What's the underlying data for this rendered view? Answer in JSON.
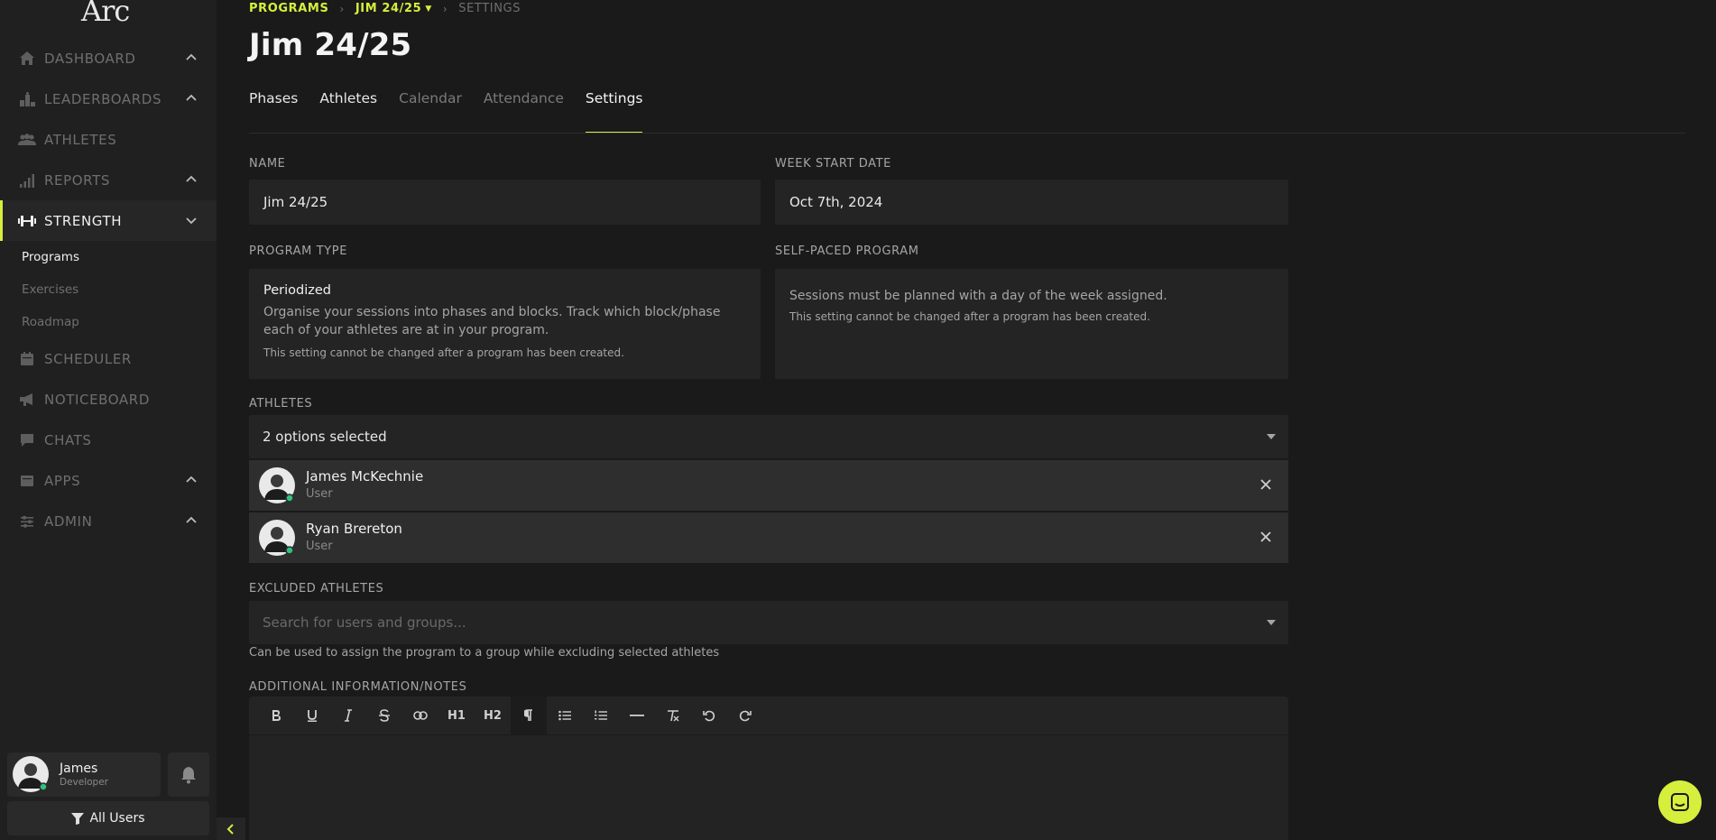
{
  "app": {
    "logo_text": "Arc",
    "brand_color": "#d6ef3c"
  },
  "sidebar": {
    "items": [
      {
        "label": "Dashboard",
        "icon": "home-icon",
        "expandable": true
      },
      {
        "label": "Leaderboards",
        "icon": "leaderboard-icon",
        "expandable": true
      },
      {
        "label": "Athletes",
        "icon": "users-icon",
        "expandable": false
      },
      {
        "label": "Reports",
        "icon": "bar-chart-icon",
        "expandable": true
      },
      {
        "label": "Strength",
        "icon": "dumbbell-icon",
        "expandable": true,
        "active": true
      },
      {
        "label": "Scheduler",
        "icon": "calendar-icon",
        "expandable": false
      },
      {
        "label": "Noticeboard",
        "icon": "megaphone-icon",
        "expandable": false
      },
      {
        "label": "Chats",
        "icon": "chat-icon",
        "expandable": false
      },
      {
        "label": "Apps",
        "icon": "apps-icon",
        "expandable": true
      },
      {
        "label": "Admin",
        "icon": "sliders-icon",
        "expandable": true
      }
    ],
    "strength_subitems": [
      {
        "label": "Programs",
        "active": true
      },
      {
        "label": "Exercises"
      },
      {
        "label": "Roadmap"
      }
    ],
    "user": {
      "name": "James",
      "role": "Developer"
    },
    "filter_label": "All Users"
  },
  "breadcrumb": {
    "programs": "PROGRAMS",
    "program": "JIM 24/25",
    "current": "SETTINGS"
  },
  "page_title": "Jim 24/25",
  "tabs": [
    {
      "label": "Phases"
    },
    {
      "label": "Athletes"
    },
    {
      "label": "Calendar"
    },
    {
      "label": "Attendance"
    },
    {
      "label": "Settings",
      "active": true
    }
  ],
  "form": {
    "name_label": "NAME",
    "name_value": "Jim 24/25",
    "week_start_label": "WEEK START DATE",
    "week_start_value": "Oct 7th, 2024",
    "program_type_label": "PROGRAM TYPE",
    "program_type": {
      "heading": "Periodized",
      "desc": "Organise your sessions into phases and blocks. Track which block/phase each of your athletes are at in your program.",
      "note": "This setting cannot be changed after a program has been created."
    },
    "self_paced_label": "SELF-PACED PROGRAM",
    "self_paced": {
      "desc": "Sessions must be planned with a day of the week assigned.",
      "note": "This setting cannot be changed after a program has been created."
    },
    "athletes_label": "ATHLETES",
    "athletes_summary": "2 options selected",
    "athletes": [
      {
        "name": "James McKechnie",
        "role": "User"
      },
      {
        "name": "Ryan Brereton",
        "role": "User"
      }
    ],
    "excluded_label": "EXCLUDED ATHLETES",
    "excluded_placeholder": "Search for users and groups...",
    "excluded_help": "Can be used to assign the program to a group while excluding selected athletes",
    "notes_label": "ADDITIONAL INFORMATION/NOTES",
    "toolbar": {
      "h1": "H1",
      "h2": "H2"
    }
  }
}
